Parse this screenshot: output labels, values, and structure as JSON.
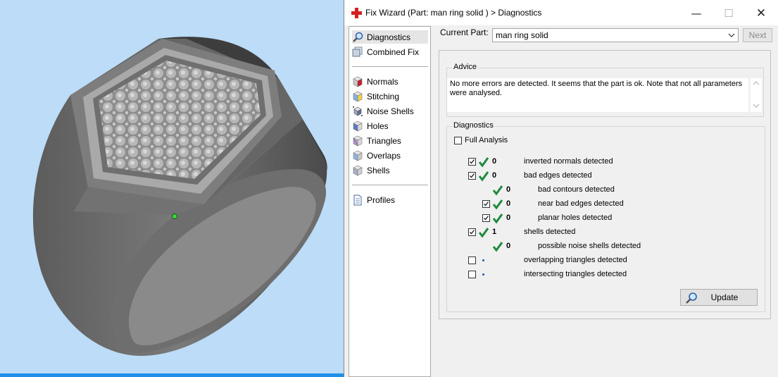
{
  "window": {
    "title": "Fix Wizard (Part: man ring solid ) > Diagnostics",
    "minimize_glyph": "—",
    "maximize_glyph": "☐",
    "close_glyph": "✕"
  },
  "nav": {
    "items": [
      {
        "label": "Diagnostics",
        "icon": "magnifier-icon",
        "selected": true
      },
      {
        "label": "Combined Fix",
        "icon": "combined-fix-icon"
      },
      {
        "label": "Normals",
        "icon": "normals-cube-icon"
      },
      {
        "label": "Stitching",
        "icon": "stitching-cube-icon"
      },
      {
        "label": "Noise Shells",
        "icon": "noise-shells-icon"
      },
      {
        "label": "Holes",
        "icon": "holes-cube-icon"
      },
      {
        "label": "Triangles",
        "icon": "triangles-cube-icon"
      },
      {
        "label": "Overlaps",
        "icon": "overlaps-cube-icon"
      },
      {
        "label": "Shells",
        "icon": "shells-cube-icon"
      },
      {
        "label": "Profiles",
        "icon": "profiles-document-icon"
      }
    ]
  },
  "part": {
    "label": "Current Part:",
    "selected": "man ring solid",
    "next_label": "Next"
  },
  "advice": {
    "title": "Advice",
    "text": "No more errors are detected. It seems that the part is ok. Note that not all parameters were analysed."
  },
  "diagnostics": {
    "title": "Diagnostics",
    "full_analysis_label": "Full Analysis",
    "full_analysis_checked": false,
    "rows": [
      {
        "checked": true,
        "status": "ok",
        "count": "0",
        "text": "inverted normals detected"
      },
      {
        "checked": true,
        "status": "ok",
        "count": "0",
        "text": "bad edges detected"
      },
      {
        "status": "ok",
        "count": "0",
        "text": "bad contours detected"
      },
      {
        "checked": true,
        "status": "ok",
        "count": "0",
        "text": "near bad edges detected"
      },
      {
        "checked": true,
        "status": "ok",
        "count": "0",
        "text": "planar holes detected"
      },
      {
        "checked": true,
        "status": "ok",
        "count": "1",
        "text": "shells detected"
      },
      {
        "status": "ok",
        "count": "0",
        "text": "possible noise shells detected"
      },
      {
        "checked": false,
        "status": "not-analysed",
        "count": "",
        "text": "overlapping triangles detected"
      },
      {
        "checked": false,
        "status": "not-analysed",
        "count": "",
        "text": "intersecting triangles detected"
      }
    ],
    "update_label": "Update"
  },
  "colors": {
    "viewport_bg": "#bcdcf7",
    "tick_green": "#1e8a3c",
    "dot_blue": "#2a4fb5",
    "title_icon_red": "#d42020"
  }
}
